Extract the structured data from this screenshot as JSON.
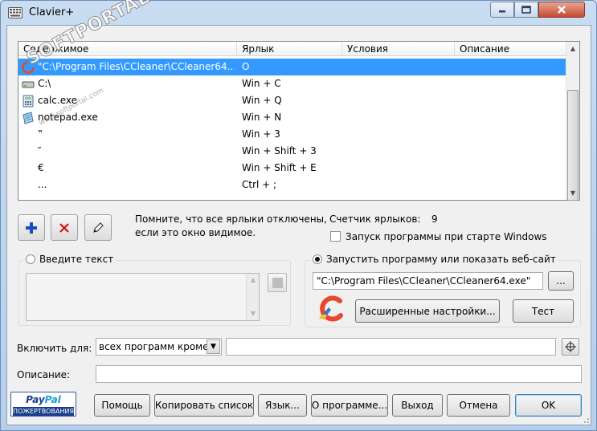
{
  "window": {
    "title": "Clavier+"
  },
  "watermark": {
    "text": "SOFTPORTAL",
    "trademark": "™",
    "url": "www.softportal.com"
  },
  "list": {
    "columns": [
      "Содержимое",
      "Ярлык",
      "Условия",
      "Описание"
    ],
    "rows": [
      {
        "content": "\"C:\\Program Files\\CCleaner\\CCleaner64....",
        "shortcut": "O",
        "icon": "ccleaner-icon",
        "selected": true
      },
      {
        "content": "C:\\",
        "shortcut": "Win + C",
        "icon": "drive-icon",
        "selected": false
      },
      {
        "content": "calc.exe",
        "shortcut": "Win + Q",
        "icon": "calculator-icon",
        "selected": false
      },
      {
        "content": "notepad.exe",
        "shortcut": "Win + N",
        "icon": "notepad-icon",
        "selected": false
      },
      {
        "content": "‟",
        "shortcut": "Win + 3",
        "icon": "",
        "selected": false
      },
      {
        "content": "″",
        "shortcut": "Win + Shift + 3",
        "icon": "",
        "selected": false
      },
      {
        "content": "€",
        "shortcut": "Win + Shift + E",
        "icon": "",
        "selected": false
      },
      {
        "content": "...",
        "shortcut": "Ctrl + ;",
        "icon": "",
        "selected": false
      }
    ]
  },
  "toolbar": {
    "add_icon": "plus-icon",
    "delete_icon": "delete-x-icon",
    "edit_icon": "pencil-icon"
  },
  "info": {
    "note_line1": "Помните, что все ярлыки отключены,",
    "note_line2": "если это окно видимое.",
    "counter_label": "Счетчик ярлыков:",
    "counter_value": "9",
    "startup_label": "Запуск программы при старте Windows",
    "startup_checked": false
  },
  "text_group": {
    "label": "Введите текст",
    "selected": false
  },
  "program_group": {
    "label": "Запустить программу или показать веб-сайт",
    "selected": true,
    "path_value": "\"C:\\Program Files\\CCleaner\\CCleaner64.exe\"",
    "browse_label": "...",
    "advanced_label": "Расширенные настройки...",
    "test_label": "Тест"
  },
  "enable_for": {
    "label": "Включить для:",
    "select_value": "всех программ кроме",
    "programs_value": ""
  },
  "description": {
    "label": "Описание:",
    "value": ""
  },
  "paypal": {
    "logo_a": "Pay",
    "logo_b": "Pal",
    "donate": "ПОЖЕРТВОВАНИЯ"
  },
  "buttons": {
    "help": "Помощь",
    "copy_list": "Копировать список",
    "language": "Язык...",
    "about": "О программе...",
    "exit": "Выход",
    "cancel": "Отмена",
    "ok": "OK"
  },
  "colors": {
    "selection": "#3399ff",
    "accent_blue": "#1450b8",
    "delete_red": "#d81010"
  }
}
